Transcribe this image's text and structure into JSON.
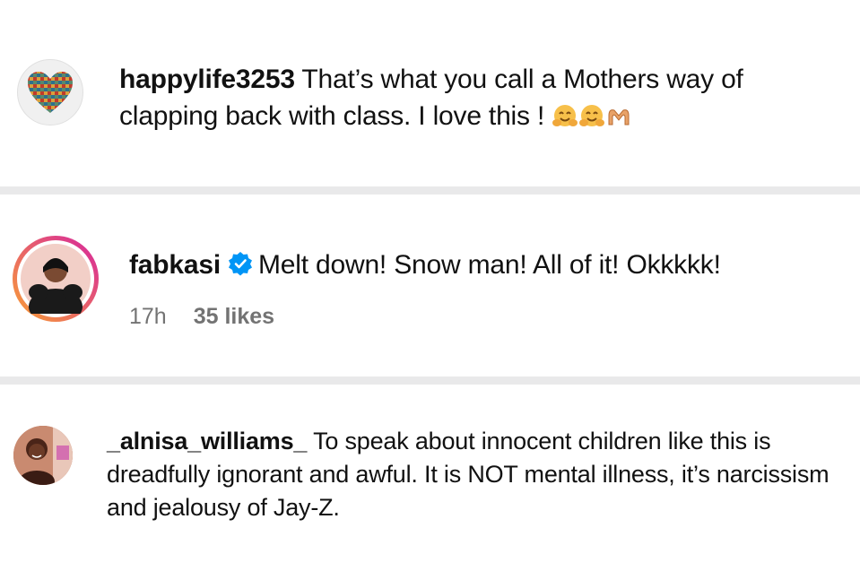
{
  "comments": [
    {
      "username": "happylife3253",
      "text": "That’s what you call a Mothers way of clapping back with class. I love this !",
      "emoji_icons": [
        "hugging-face-icon",
        "hugging-face-icon",
        "heart-hands-icon"
      ],
      "avatar_icon": "heart-mosaic-avatar"
    },
    {
      "username": "fabkasi",
      "verified": true,
      "text": "Melt down! Snow man! All of it! Okkkkk!",
      "time": "17h",
      "likes": "35 likes",
      "avatar_icon": "story-ring-avatar"
    },
    {
      "username": "_alnisa_williams_",
      "text": "To speak about innocent children like this is dreadfully ignorant and awful. It is NOT mental illness, it’s narcissism and jealousy of Jay-Z.",
      "avatar_icon": "profile-photo-avatar"
    }
  ],
  "colors": {
    "divider": "#e9e9ea",
    "verified": "#0095f6",
    "meta_text": "#737373",
    "story_ring_start": "#f9a134",
    "story_ring_end": "#d6249f"
  }
}
